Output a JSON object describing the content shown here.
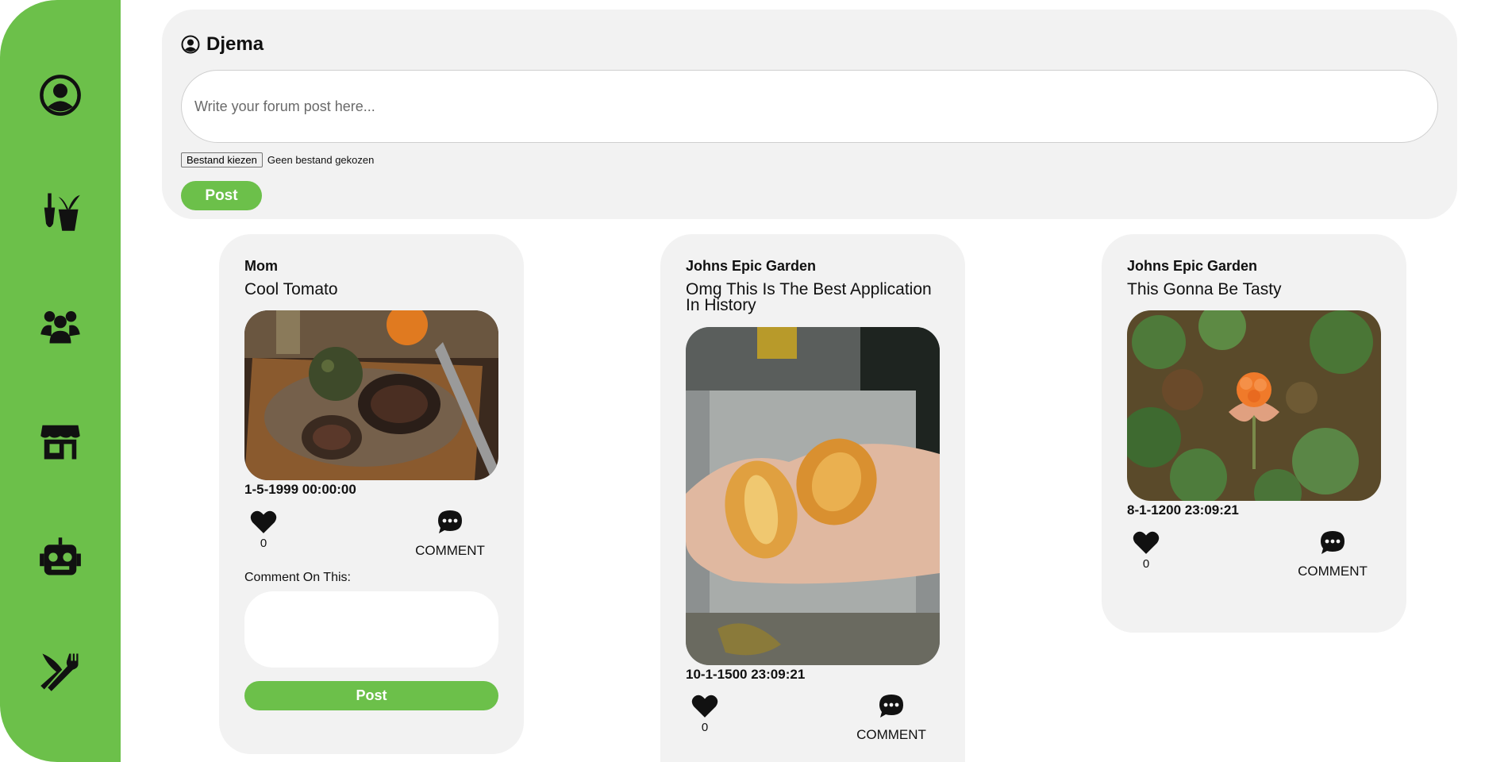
{
  "sidebar": {
    "items": [
      {
        "icon": "profile-icon"
      },
      {
        "icon": "garden-tools-icon"
      },
      {
        "icon": "community-icon"
      },
      {
        "icon": "store-icon"
      },
      {
        "icon": "robot-icon"
      },
      {
        "icon": "utensils-icon"
      }
    ],
    "accent": "#6cc04a"
  },
  "composer": {
    "username": "Djema",
    "placeholder": "Write your forum post here...",
    "file_button": "Bestand kiezen",
    "file_status": "Geen bestand gekozen",
    "post_label": "Post"
  },
  "posts": [
    {
      "user": "Mom",
      "title": "Cool Tomato",
      "date": "1-5-1999 00:00:00",
      "likes": "0",
      "comment_label": "COMMENT",
      "comment_prompt": "Comment On This:",
      "comment_post_label": "Post",
      "image_icon": "tomato-photo"
    },
    {
      "user": "Johns Epic Garden",
      "title": "Omg This Is The Best Application In History",
      "date": "10-1-1500 23:09:21",
      "likes": "0",
      "comment_label": "COMMENT",
      "image_icon": "fruit-in-hand-photo"
    },
    {
      "user": "Johns Epic Garden",
      "title": "This Gonna Be Tasty",
      "date": "8-1-1200 23:09:21",
      "likes": "0",
      "comment_label": "COMMENT",
      "image_icon": "cloudberry-photo"
    }
  ]
}
